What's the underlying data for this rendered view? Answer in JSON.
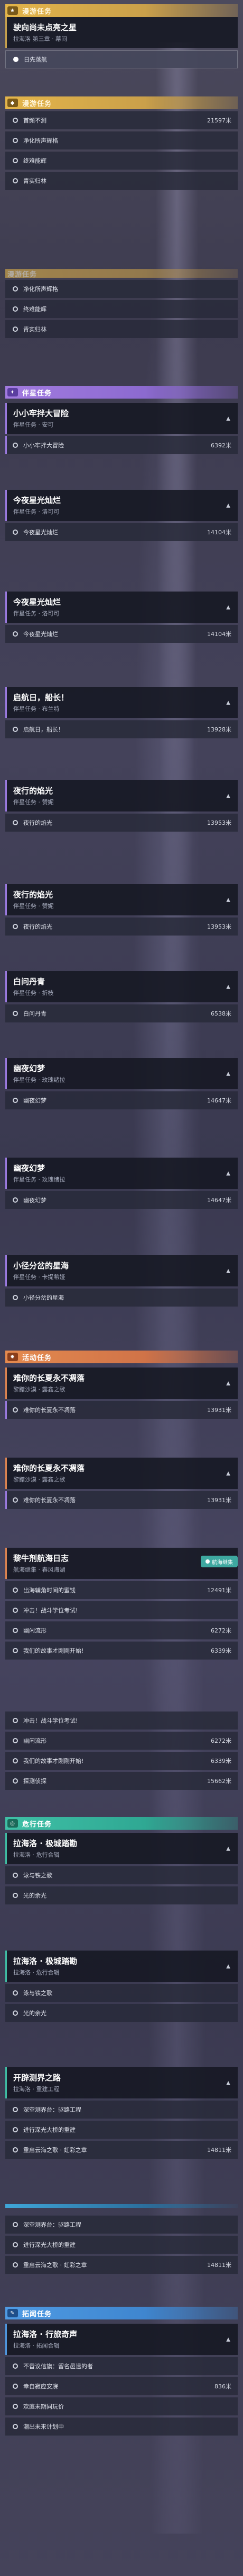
{
  "sections": {
    "s1": {
      "title": "漫游任务",
      "tag": "★",
      "card": {
        "title": "驶向尚未点亮之星",
        "sub": "拉海洛 第三章 · 幕间"
      },
      "rows": [
        {
          "label": "日先落航",
          "dist": ""
        }
      ]
    },
    "s2": {
      "title": "漫游任务",
      "tag": "◆",
      "rows": [
        {
          "label": "首频不测",
          "dist": "21597米"
        },
        {
          "label": "净化所声辉格",
          "dist": ""
        },
        {
          "label": "终难能辉",
          "dist": ""
        },
        {
          "label": "青实归林",
          "dist": ""
        }
      ]
    },
    "s3": {
      "title": "漫游任务",
      "rows": [
        {
          "label": "净化所声辉格",
          "dist": ""
        },
        {
          "label": "终难能辉",
          "dist": ""
        },
        {
          "label": "青实归林",
          "dist": ""
        }
      ]
    },
    "s4": {
      "title": "伴星任务",
      "tag": "✦",
      "cards": [
        {
          "title": "小小牢拌大冒险",
          "sub": "伴星任务 · 安可",
          "row": {
            "label": "小小牢拌大冒险",
            "dist": "6392米"
          }
        },
        {
          "title": "今夜星光灿烂",
          "sub": "伴星任务 · 洛可可",
          "row": {
            "label": "今夜星光灿烂",
            "dist": "14104米"
          }
        },
        {
          "title": "今夜星光灿烂",
          "sub": "伴星任务 · 洛可可",
          "row": {
            "label": "今夜星光灿烂",
            "dist": "14104米"
          }
        },
        {
          "title": "启航日，船长！",
          "sub": "伴星任务 · 布兰特",
          "row": {
            "label": "启航日，船长！",
            "dist": "13928米"
          }
        },
        {
          "title": "夜行的焰光",
          "sub": "伴星任务 · 赞妮",
          "row": {
            "label": "夜行的焰光",
            "dist": "13953米"
          }
        },
        {
          "title": "夜行的焰光",
          "sub": "伴星任务 · 赞妮",
          "row": {
            "label": "夜行的焰光",
            "dist": "13953米"
          }
        },
        {
          "title": "白问丹青",
          "sub": "伴星任务 · 折枝",
          "row": {
            "label": "白问丹青",
            "dist": "6538米"
          }
        },
        {
          "title": "幽夜幻梦",
          "sub": "伴星任务 · 玫瑰绪拉",
          "row": {
            "label": "幽夜幻梦",
            "dist": "14647米"
          }
        },
        {
          "title": "幽夜幻梦",
          "sub": "伴星任务 · 玫瑰绪拉",
          "row": {
            "label": "幽夜幻梦",
            "dist": "14647米"
          }
        },
        {
          "title": "小径分岔的星海",
          "sub": "伴星任务 · 卡提希娅",
          "row": {
            "label": "小径分岔的星海",
            "dist": ""
          }
        }
      ]
    },
    "s5": {
      "title": "活动任务",
      "tag": "✹",
      "cards": [
        {
          "title": "难你的长夏永不凋落",
          "sub": "黎黯沙漠 · 露鑫之歌",
          "row": {
            "label": "难你的长夏永不凋落",
            "dist": "13931米"
          }
        },
        {
          "title": "难你的长夏永不凋落",
          "sub": "黎黯沙漠 · 露鑫之歌",
          "row": {
            "label": "难你的长夏永不凋落",
            "dist": "13931米"
          }
        },
        {
          "title": "黎牛剂航海日志",
          "sub": "航海继集 · 春风海湖",
          "rows": [
            {
              "label": "出海辅角时间的蜜饯",
              "dist": "12491米"
            },
            {
              "label": "冲击！战斗学位考试!",
              "dist": ""
            },
            {
              "label": "幽闲流形",
              "dist": "6272米"
            },
            {
              "label": "我们的故事才刚刚开始!",
              "dist": "6339米"
            }
          ]
        },
        {
          "rows": [
            {
              "label": "冲击！战斗学位考试!",
              "dist": ""
            },
            {
              "label": "幽闲流形",
              "dist": "6272米"
            },
            {
              "label": "我们的故事才刚刚开始!",
              "dist": "6339米"
            },
            {
              "label": "探测侦探",
              "dist": "15662米"
            }
          ]
        }
      ],
      "pin": "航海继集"
    },
    "s6": {
      "title": "危行任务",
      "tag": "◎",
      "cards": [
        {
          "title": "拉海洛 · 极城踏勘",
          "sub": "拉海洛 · 危行合辑",
          "rows": [
            {
              "label": "泳与铁之歌",
              "dist": ""
            },
            {
              "label": "光的余光",
              "dist": ""
            }
          ]
        },
        {
          "title": "拉海洛 · 极城踏勘",
          "sub": "拉海洛 · 危行合辑",
          "rows": [
            {
              "label": "泳与铁之歌",
              "dist": ""
            },
            {
              "label": "光的余光",
              "dist": ""
            }
          ]
        },
        {
          "title": "开辟测界之路",
          "sub": "拉海洛 · 重建工程",
          "rows": [
            {
              "label": "深空测界台：驱路工程",
              "dist": ""
            },
            {
              "label": "进行深光大桥的重建",
              "dist": ""
            },
            {
              "label": "重启云海之歌 · 虹彩之章",
              "dist": "14811米"
            }
          ]
        },
        {
          "rows": [
            {
              "label": "深空测界台：驱路工程",
              "dist": ""
            },
            {
              "label": "进行深光大桥的重建",
              "dist": ""
            },
            {
              "label": "重启云海之歌 · 虹彩之章",
              "dist": "14811米"
            }
          ]
        }
      ]
    },
    "s7": {
      "title": "拓闻任务",
      "tag": "✎",
      "card": {
        "title": "拉海洛 · 行旅奇声",
        "sub": "拉海洛 · 拓闻合辑"
      },
      "rows": [
        {
          "label": "不啻议信旗：留名邑遣的者",
          "dist": ""
        },
        {
          "label": "幸自寂应安寐",
          "dist": "836米"
        },
        {
          "label": "欢庭未期同玩价",
          "dist": ""
        },
        {
          "label": "潮出未来计划中",
          "dist": ""
        }
      ]
    }
  }
}
